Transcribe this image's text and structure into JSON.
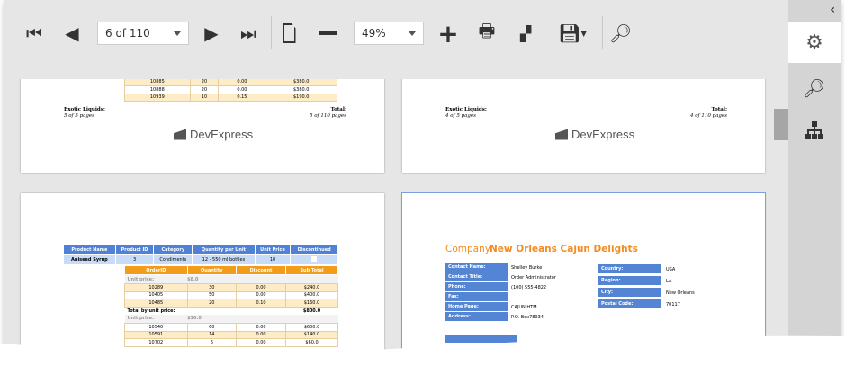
{
  "toolbar": {
    "page_selector": "6 of 110",
    "zoom": "49%",
    "icons": [
      "first-page-icon",
      "previous-page-icon",
      "next-page-icon",
      "last-page-icon",
      "single-page-icon",
      "zoom-out-icon",
      "zoom-in-icon",
      "print-icon",
      "print-direct-icon",
      "export-icon",
      "search-icon"
    ]
  },
  "panel": {
    "icons": [
      "collapse-chevron-icon",
      "parameters-gear-icon",
      "search-icon",
      "document-map-icon"
    ]
  },
  "colors": {
    "header_blue": "#4f81d6",
    "header_orange": "#f39b1b",
    "row_alt": "#fdecc5",
    "company_orange": "#f58b1f"
  },
  "pages": {
    "top_rows": [
      [
        "10866",
        "21",
        "0.25",
        "$399.0"
      ],
      [
        "10885",
        "20",
        "0.00",
        "$380.0"
      ],
      [
        "10888",
        "20",
        "0.00",
        "$380.0"
      ],
      [
        "10939",
        "10",
        "0.15",
        "$190.0"
      ]
    ],
    "p1": {
      "group": "Exotic Liquids:",
      "group_pages": "5 of 5 pages",
      "total": "Total:",
      "total_pages": "5 of 110 pages"
    },
    "p2": {
      "group": "Exotic Liquids:",
      "group_pages": "4 of 5 pages",
      "total": "Total:",
      "total_pages": "4 of 110 pages"
    },
    "logo": "DevExpress",
    "p3": {
      "product_headers": [
        "Product Name",
        "Product ID",
        "Category",
        "Quantity per Unit",
        "Unit Price",
        "Discontinued"
      ],
      "product_row": [
        "Aniseed Syrup",
        "3",
        "Condiments",
        "12 - 550 ml bottles",
        "10",
        ""
      ],
      "order_headers": [
        "OrderID",
        "Quantity",
        "Discount",
        "Sub Total"
      ],
      "unit_price_label": "Unit price:",
      "unit_price_1": "$8.0",
      "unit_price_2": "$10.0",
      "rows1": [
        [
          "10289",
          "30",
          "0.00",
          "$240.0"
        ],
        [
          "10405",
          "50",
          "0.00",
          "$400.0"
        ],
        [
          "10485",
          "20",
          "0.10",
          "$160.0"
        ]
      ],
      "total_label": "Total by unit price:",
      "total_value": "$800.0",
      "rows2": [
        [
          "10540",
          "60",
          "0.00",
          "$600.0"
        ],
        [
          "10591",
          "14",
          "0.00",
          "$140.0"
        ],
        [
          "10702",
          "6",
          "0.00",
          "$60.0"
        ]
      ]
    },
    "p4": {
      "company_label": "Company",
      "company_name": "New Orleans Cajun Delights",
      "left": [
        [
          "Contact Name:",
          "Shelley Burke"
        ],
        [
          "Contact Title:",
          "Order Administrator"
        ],
        [
          "Phone:",
          "(100) 555-4822"
        ],
        [
          "Fax:",
          ""
        ],
        [
          "Home Page:",
          "CAJUN.HTM"
        ],
        [
          "Address:",
          "P.O. Box78934"
        ]
      ],
      "right": [
        [
          "Country:",
          "USA"
        ],
        [
          "Region:",
          "LA"
        ],
        [
          "City:",
          "New Orleans"
        ],
        [
          "Postal Code:",
          "70117"
        ]
      ]
    }
  }
}
